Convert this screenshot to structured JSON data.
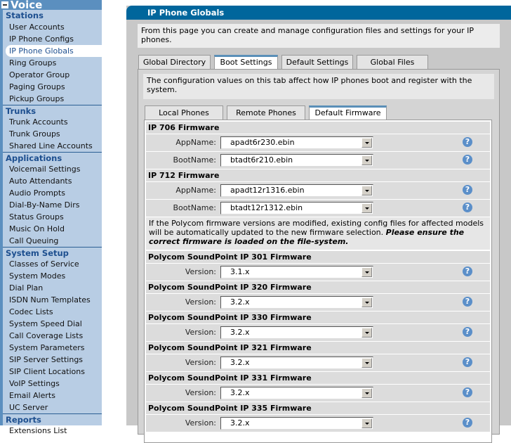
{
  "sidebar": {
    "title": "Voice",
    "groups": [
      {
        "label": "Stations",
        "items": [
          "User Accounts",
          "IP Phone Configs",
          "IP Phone Globals",
          "Ring Groups",
          "Operator Group",
          "Paging Groups",
          "Pickup Groups"
        ]
      },
      {
        "label": "Trunks",
        "items": [
          "Trunk Accounts",
          "Trunk Groups",
          "Shared Line Accounts"
        ]
      },
      {
        "label": "Applications",
        "items": [
          "Voicemail Settings",
          "Auto Attendants",
          "Audio Prompts",
          "Dial-By-Name Dirs",
          "Status Groups",
          "Music On Hold",
          "Call Queuing"
        ]
      },
      {
        "label": "System Setup",
        "items": [
          "Classes of Service",
          "System Modes",
          "Dial Plan",
          "ISDN Num Templates",
          "Codec Lists",
          "System Speed Dial",
          "Call Coverage Lists",
          "System Parameters",
          "SIP Server Settings",
          "SIP Client Locations",
          "VoIP Settings",
          "Email Alerts",
          "UC Server"
        ]
      },
      {
        "label": "Reports",
        "items": [
          "Extensions List"
        ]
      }
    ],
    "selected": "IP Phone Globals"
  },
  "main": {
    "title": "IP Phone Globals",
    "intro": "From this page you can create and manage configuration files and settings for your IP phones.",
    "tabs": [
      "Global Directory",
      "Boot Settings",
      "Default Settings",
      "Global Files"
    ],
    "active_tab": "Boot Settings",
    "description": "The configuration values on this tab affect how IP phones boot and register with the system.",
    "subtabs": [
      "Local Phones",
      "Remote Phones",
      "Default Firmware"
    ],
    "active_subtab": "Default Firmware",
    "firmware": {
      "ip706": {
        "title": "IP 706 Firmware",
        "app_label": "AppName:",
        "app_value": "apadt6r230.ebin",
        "boot_label": "BootName:",
        "boot_value": "btadt6r210.ebin"
      },
      "ip712": {
        "title": "IP 712 Firmware",
        "app_label": "AppName:",
        "app_value": "apadt12r1316.ebin",
        "boot_label": "BootName:",
        "boot_value": "btadt12r1312.ebin"
      },
      "note": "If the Polycom firmware versions are modified, existing config files for affected models will be automatically updated to the new firmware selection. ",
      "note_bold": "Please ensure the correct firmware is loaded on the file-system.",
      "polycom": [
        {
          "title": "Polycom SoundPoint IP 301 Firmware",
          "label": "Version:",
          "value": "3.1.x"
        },
        {
          "title": "Polycom SoundPoint IP 320 Firmware",
          "label": "Version:",
          "value": "3.2.x"
        },
        {
          "title": "Polycom SoundPoint IP 330 Firmware",
          "label": "Version:",
          "value": "3.2.x"
        },
        {
          "title": "Polycom SoundPoint IP 321 Firmware",
          "label": "Version:",
          "value": "3.2.x"
        },
        {
          "title": "Polycom SoundPoint IP 331 Firmware",
          "label": "Version:",
          "value": "3.2.x"
        },
        {
          "title": "Polycom SoundPoint IP 335 Firmware",
          "label": "Version:",
          "value": "3.2.x"
        }
      ]
    },
    "help_glyph": "?"
  },
  "colors": {
    "header": "#00669c",
    "sidebar": "#b8cde4",
    "group_text": "#1d4f8f"
  }
}
